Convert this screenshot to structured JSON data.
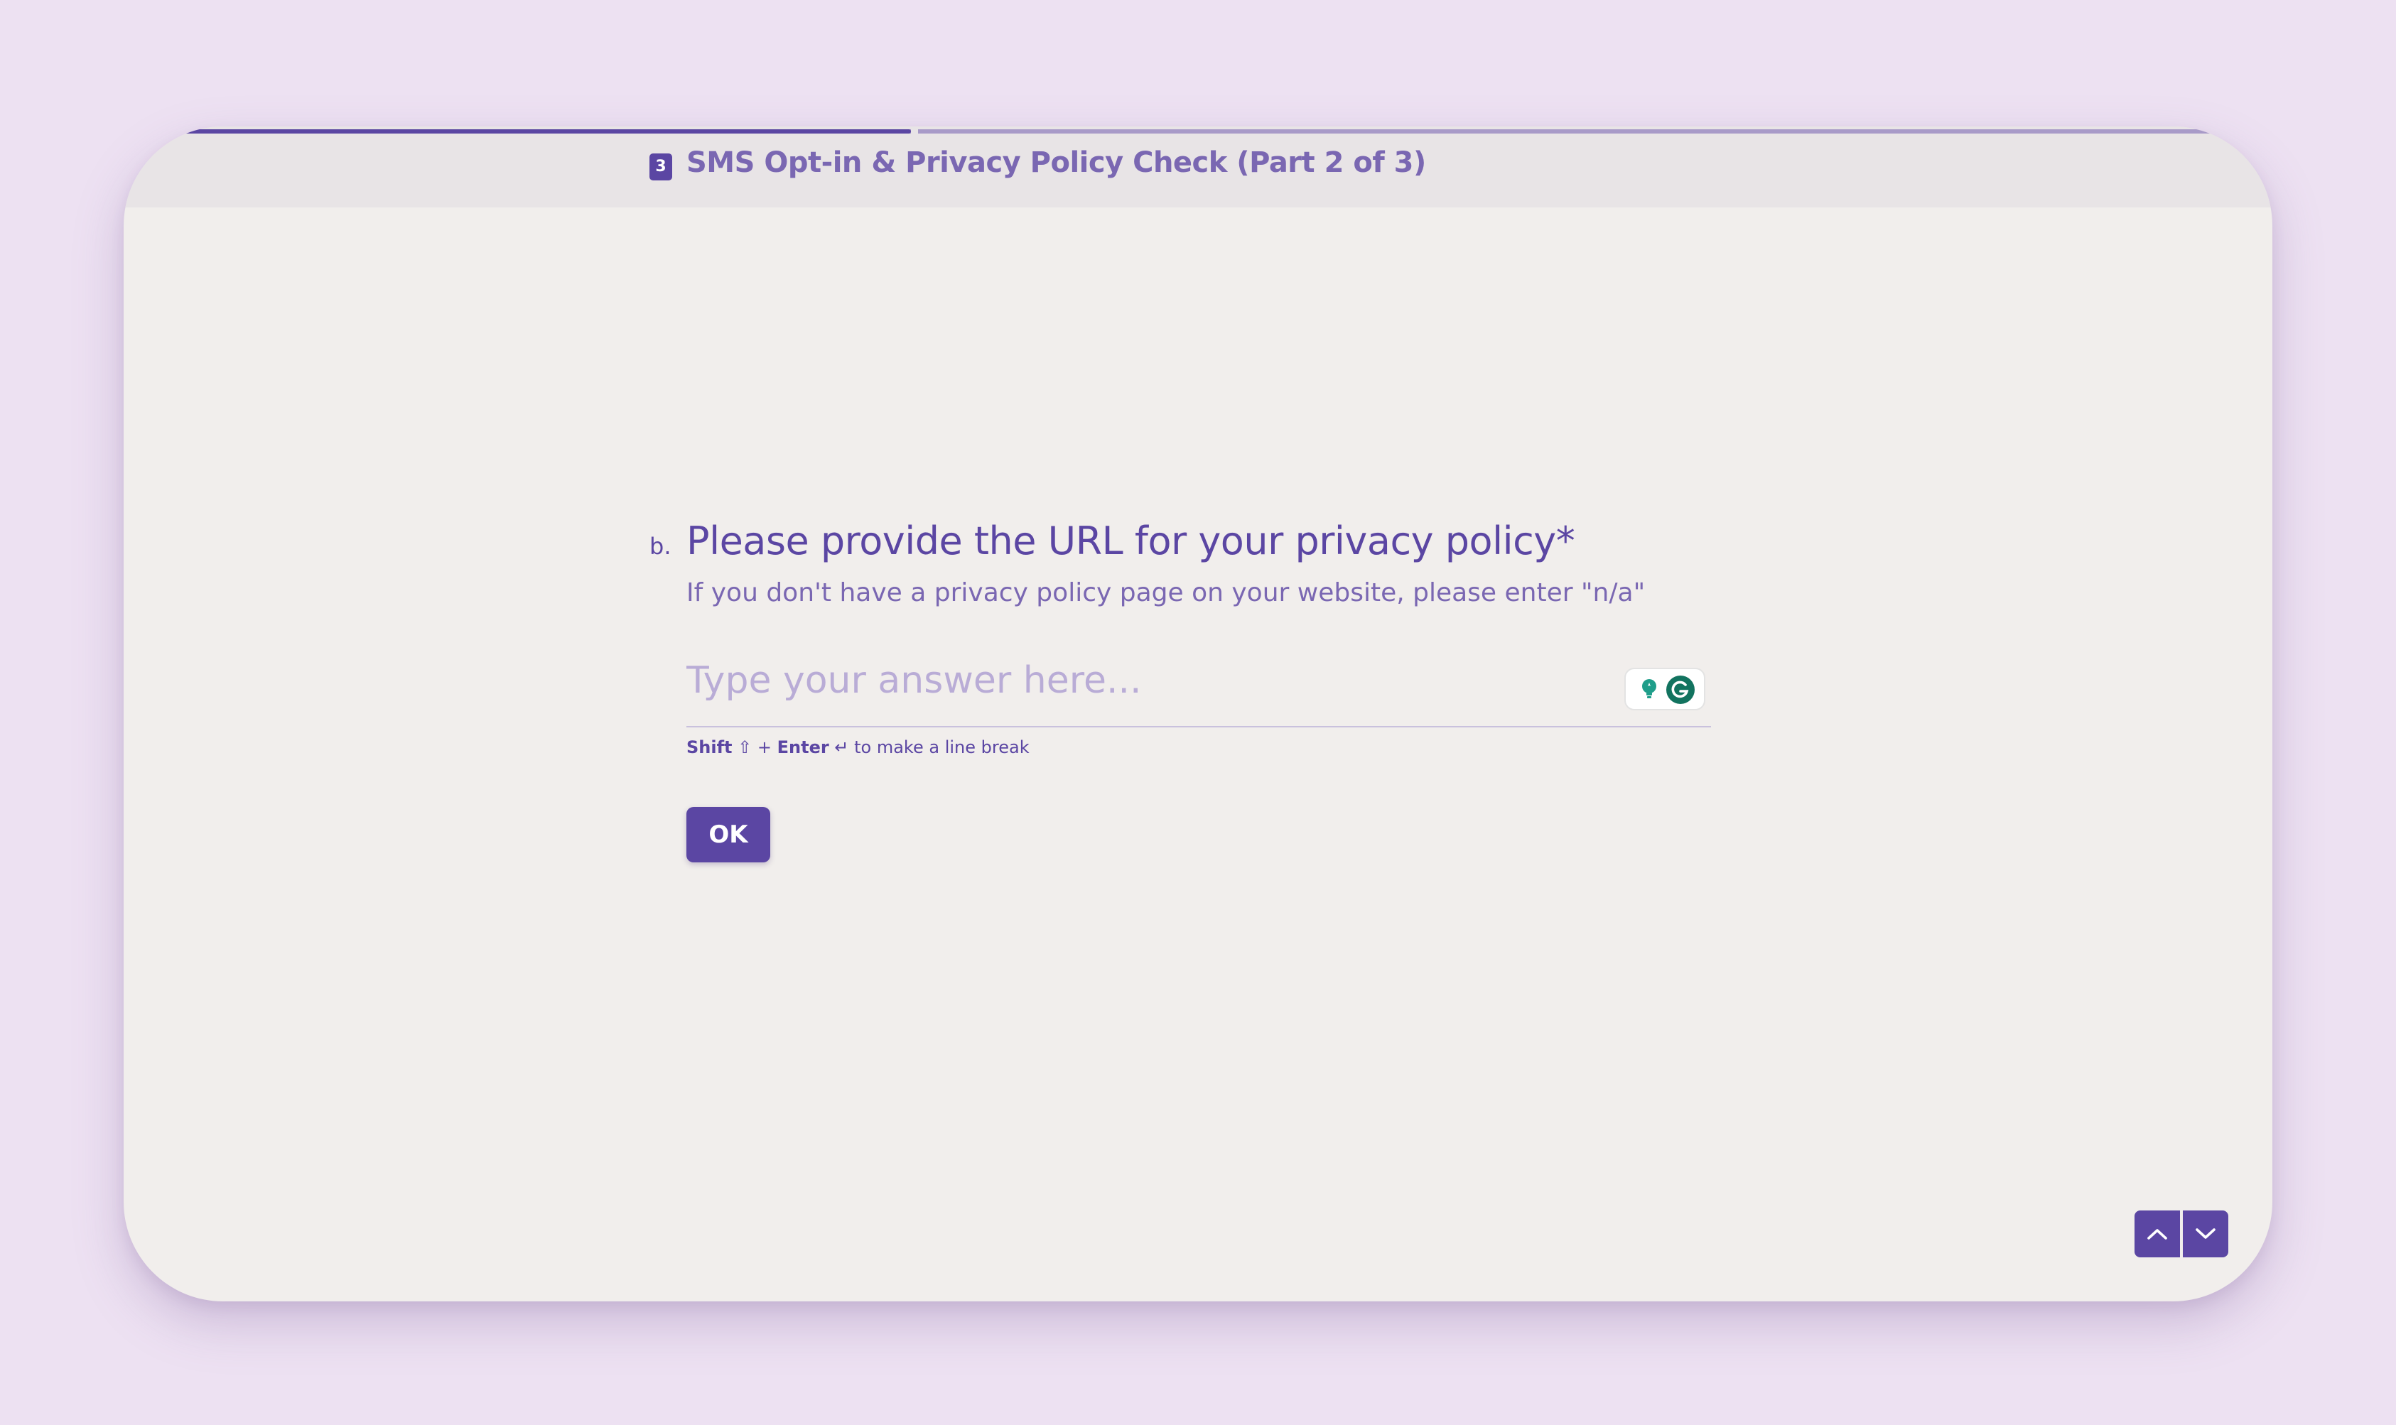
{
  "header": {
    "section_number": "3",
    "section_title": "SMS Opt-in & Privacy Policy Check (Part 2 of 3)"
  },
  "progress": {
    "fraction_complete": 0.36
  },
  "question": {
    "letter": "b.",
    "title": "Please provide the URL for your privacy policy*",
    "description": "If you don't have a privacy policy page on your website, please enter \"n/a\"",
    "answer_value": "",
    "answer_placeholder": "Type your answer here..."
  },
  "hint": {
    "shift_label": "Shift",
    "shift_icon": "⇧",
    "plus": "+",
    "enter_label": "Enter",
    "enter_icon": "↵",
    "suffix": "to make a line break"
  },
  "ok_button": {
    "label": "OK"
  },
  "colors": {
    "page_background": "#ede1f2",
    "card_background": "#f1eeec",
    "accent": "#5b46a3",
    "accent_light": "#7a67b2",
    "placeholder": "#b9acd6"
  },
  "icons": {
    "extension_bulb": "bulb-icon",
    "extension_grammarly": "grammarly-icon",
    "nav_up": "chevron-up-icon",
    "nav_down": "chevron-down-icon"
  }
}
